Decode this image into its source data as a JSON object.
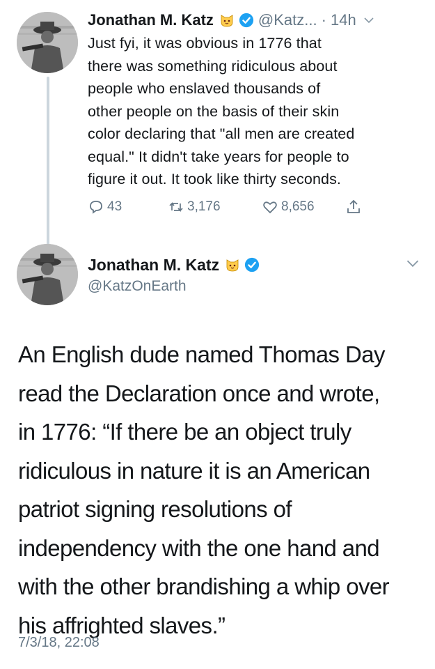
{
  "tweet1": {
    "author_name": "Jonathan M. Katz",
    "handle": "@Katz...",
    "time": "· 14h",
    "body": "Just fyi, it was obvious in 1776 that\nthere was something ridiculous about\npeople who enslaved thousands of\nother people on the basis of their skin\ncolor declaring that \"all men are created\nequal.\" It didn't take years for people to\nfigure it out. It took like thirty seconds.",
    "replies": "43",
    "retweets": "3,176",
    "likes": "8,656"
  },
  "tweet2": {
    "author_name": "Jonathan M. Katz",
    "handle": "@KatzOnEarth",
    "body": "An English dude named Thomas Day\nread the Declaration once and wrote,\nin 1776: “If there be an object truly\nridiculous in nature it is an American\npatriot signing resolutions of\nindependency with the one hand and\nwith the other brandishing a whip over\nhis affrighted slaves.”",
    "timestamp": "7/3/18, 22:08"
  },
  "icons": {
    "badge_emoji": "cat-face-icon",
    "verified": "verified-badge-icon",
    "reply": "reply-icon",
    "retweet": "retweet-icon",
    "like": "heart-icon",
    "share": "share-icon",
    "menu": "chevron-down-icon"
  },
  "colors": {
    "verified_blue": "#1da1f2",
    "secondary_text": "#657786",
    "thread_line": "#ccd6dd"
  }
}
